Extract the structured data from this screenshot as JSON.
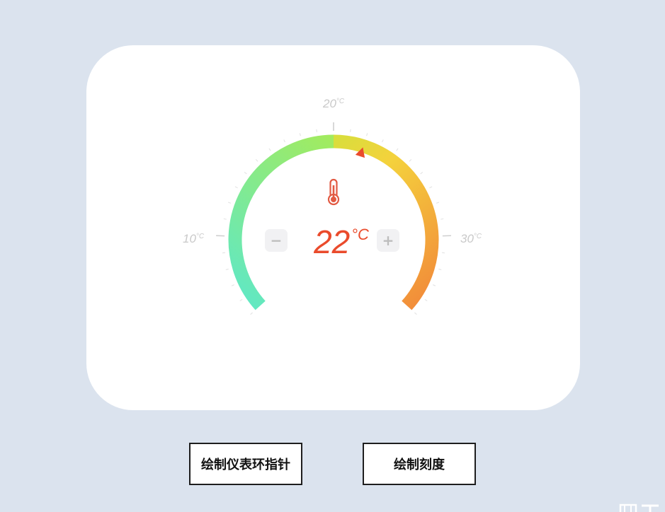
{
  "gauge": {
    "min": 5,
    "max": 35,
    "value": 22,
    "value_text": "22",
    "unit": "°C",
    "scale_labels": [
      {
        "text": "10",
        "unit": "°C"
      },
      {
        "text": "20",
        "unit": "°C"
      },
      {
        "text": "30",
        "unit": "°C"
      }
    ],
    "colors": {
      "start": "#5ee8c8",
      "middle": "#b8ec3c",
      "end": "#f2883a",
      "pointer": "#ea4b2c",
      "thermometer": "#e25a43"
    },
    "minus_label": "−",
    "plus_label": "+"
  },
  "buttons": {
    "draw_ring_pointer": "绘制仪表环指针",
    "draw_scale": "绘制刻度"
  }
}
